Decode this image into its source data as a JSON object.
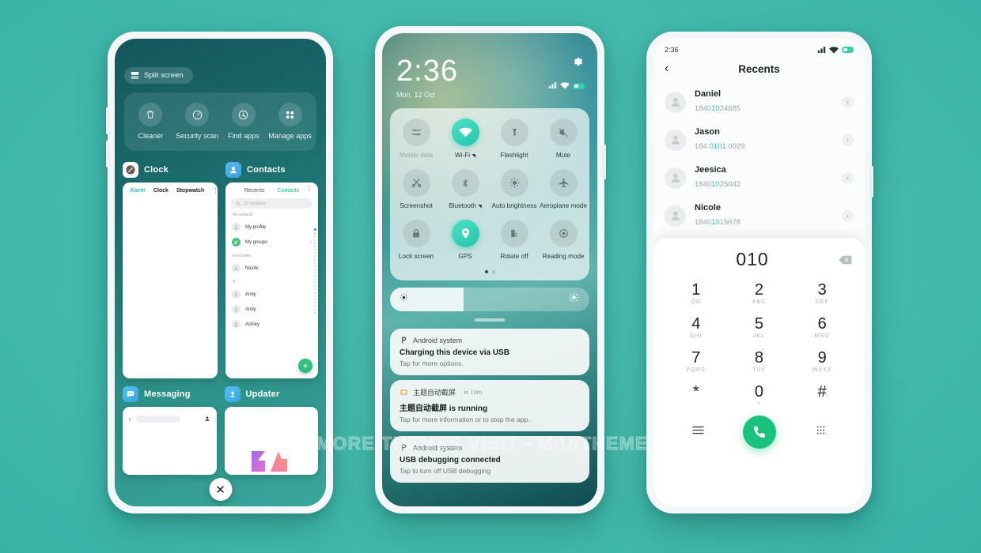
{
  "background_color": "#45bcae",
  "watermark": {
    "text": "FOR MORE THEMES VISIT - MIUITHEMEZ.COM"
  },
  "phone1": {
    "split_screen": {
      "label": "Split screen",
      "icon": "split-screen-icon"
    },
    "tools": [
      {
        "label": "Cleaner",
        "icon": "trash-icon"
      },
      {
        "label": "Security scan",
        "icon": "shield-check-icon"
      },
      {
        "label": "Find apps",
        "icon": "search-circle-icon"
      },
      {
        "label": "Manage apps",
        "icon": "grid-apps-icon"
      }
    ],
    "cards": [
      {
        "app": "Clock",
        "icon": "clock-icon",
        "tabs": [
          "Alarm",
          "Clock",
          "Stopwatch"
        ],
        "active_tab": "Alarm",
        "menu_icon": "kebab-menu-icon"
      },
      {
        "app": "Contacts",
        "icon": "contacts-icon",
        "tabs": [
          "Recents",
          "Contacts"
        ],
        "active_tab": "Contacts",
        "search_placeholder": "22 contacts",
        "section_all": "All contacts",
        "section_favourites": "Favourites",
        "section_a": "A",
        "items": [
          "My profile",
          "My groups",
          "Nicole",
          "Andy",
          "Andy",
          "Ashley"
        ],
        "fab_label": "+"
      },
      {
        "app": "Messaging",
        "icon": "message-icon"
      },
      {
        "app": "Updater",
        "icon": "updater-icon"
      }
    ],
    "close_all": {
      "label": "✕"
    }
  },
  "phone2": {
    "time": "2:36",
    "date": "Mon, 12 Oct",
    "gear_icon": "gear-icon",
    "status_icons": [
      "signal-icon",
      "wifi-icon",
      "battery-icon"
    ],
    "quick_settings": [
      {
        "label": "Mobile data",
        "icon": "mobile-data-icon",
        "on": false,
        "dim": true
      },
      {
        "label": "Wi-Fi",
        "icon": "wifi-icon",
        "on": true,
        "suffix": "signal"
      },
      {
        "label": "Flashlight",
        "icon": "flashlight-icon",
        "on": false
      },
      {
        "label": "Mute",
        "icon": "mute-icon",
        "on": false
      },
      {
        "label": "Screenshot",
        "icon": "scissors-icon",
        "on": false
      },
      {
        "label": "Bluetooth",
        "icon": "bluetooth-icon",
        "on": false,
        "suffix": "signal"
      },
      {
        "label": "Auto brightness",
        "icon": "brightness-auto-icon",
        "on": false
      },
      {
        "label": "Aeroplane mode",
        "icon": "airplane-icon",
        "on": false
      },
      {
        "label": "Lock screen",
        "icon": "lock-icon",
        "on": false
      },
      {
        "label": "GPS",
        "icon": "location-pin-icon",
        "on": true
      },
      {
        "label": "Rotate off",
        "icon": "rotate-off-icon",
        "on": false
      },
      {
        "label": "Reading mode",
        "icon": "reading-mode-icon",
        "on": false
      }
    ],
    "page_dots": {
      "count": 2,
      "active": 0
    },
    "brightness": {
      "value_percent": 37,
      "low_icon": "brightness-low-icon",
      "high_icon": "brightness-high-icon"
    },
    "notifications": [
      {
        "app": "Android system",
        "app_icon": "android-system-icon",
        "time": "",
        "title": "Charging this device via USB",
        "body": "Tap for more options."
      },
      {
        "app": "主题自动截屏",
        "app_icon": "theme-screenshot-icon",
        "time": "in 10m",
        "title": "主题自动截屏 is running",
        "body": "Tap for more information or to stop the app."
      },
      {
        "app": "Android system",
        "app_icon": "android-system-icon",
        "time": "",
        "title": "USB debugging connected",
        "body": "Tap to turn off USB debugging"
      }
    ]
  },
  "phone3": {
    "time": "2:36",
    "status_icons": [
      "signal-icon",
      "wifi-icon",
      "battery-icon"
    ],
    "back_icon": "back-chevron-icon",
    "title": "Recents",
    "recents": [
      {
        "name": "Daniel",
        "number_pre": "1840",
        "number_hl": "10",
        "number_post": "24685"
      },
      {
        "name": "Jason",
        "number_pre": "184 ",
        "number_hl": "0101",
        "number_post": " 0029"
      },
      {
        "name": "Jeesica",
        "number_pre": "1840",
        "number_hl": "10",
        "number_post": "25042"
      },
      {
        "name": "Nicole",
        "number_pre": "1840",
        "number_hl": "10",
        "number_post": "15678"
      }
    ],
    "dialed_number": "010",
    "delete_icon": "backspace-icon",
    "keys": [
      {
        "digit": "1",
        "letters": "QD"
      },
      {
        "digit": "2",
        "letters": "ABC"
      },
      {
        "digit": "3",
        "letters": "DEF"
      },
      {
        "digit": "4",
        "letters": "GHI"
      },
      {
        "digit": "5",
        "letters": "JKL"
      },
      {
        "digit": "6",
        "letters": "MNO"
      },
      {
        "digit": "7",
        "letters": "PQRS"
      },
      {
        "digit": "8",
        "letters": "TUV"
      },
      {
        "digit": "9",
        "letters": "WXYZ"
      },
      {
        "digit": "*",
        "letters": ""
      },
      {
        "digit": "0",
        "letters": "+"
      },
      {
        "digit": "#",
        "letters": ""
      }
    ],
    "actions": [
      {
        "icon": "menu-lines-icon"
      },
      {
        "icon": "call-icon"
      },
      {
        "icon": "keypad-grid-icon"
      }
    ],
    "accent_color": "#19c37d",
    "highlight_color": "#2ec7a6"
  }
}
